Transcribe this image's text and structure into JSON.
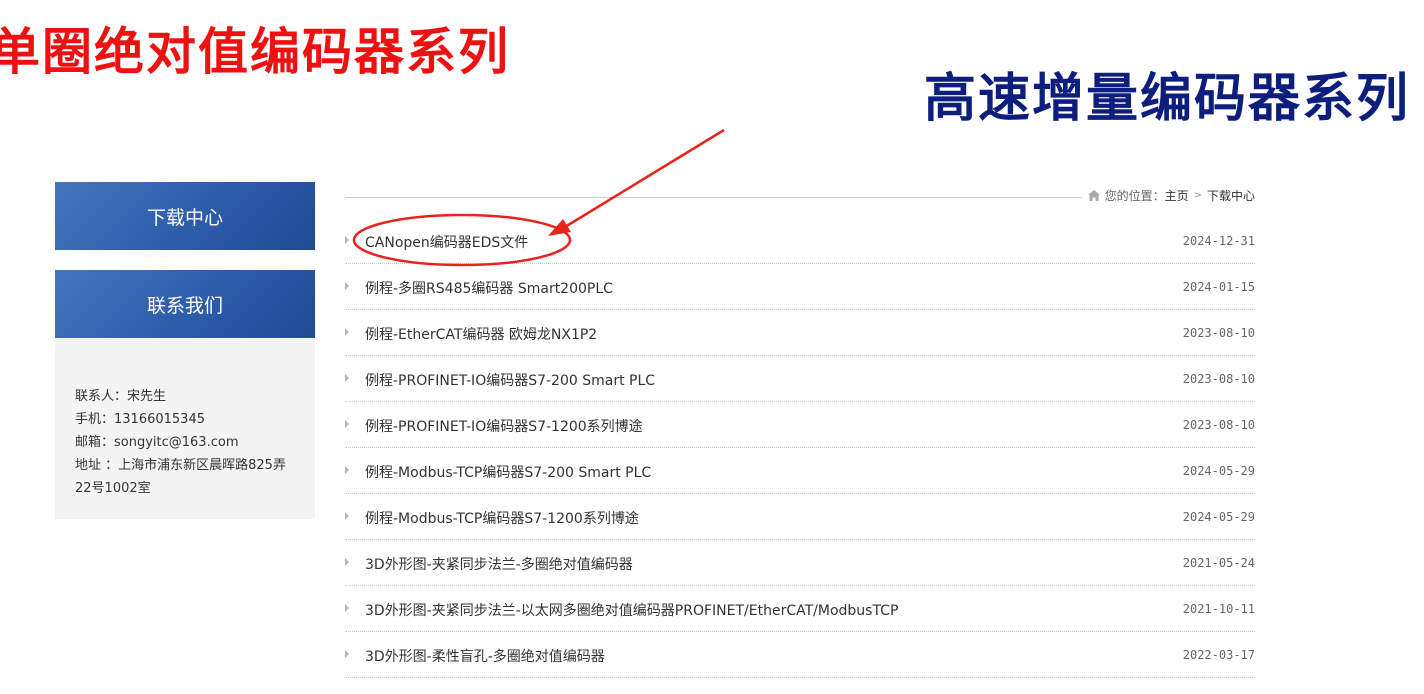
{
  "banners": {
    "left": "单圈绝对值编码器系列",
    "right": "高速增量编码器系列"
  },
  "sidebar": {
    "download_center": "下载中心",
    "contact_us": "联系我们",
    "contact": {
      "person": "联系人：宋先生",
      "phone": "手机：13166015345",
      "email": "邮箱：songyitc@163.com",
      "address": "地址 ：上海市浦东新区晨晖路825弄22号1002室"
    }
  },
  "breadcrumb": {
    "icon": "home-icon",
    "label": "您的位置：",
    "home": "主页",
    "separator": ">",
    "current": "下载中心"
  },
  "downloads": [
    {
      "title": "CANopen编码器EDS文件",
      "date": "2024-12-31"
    },
    {
      "title": "例程-多圈RS485编码器 Smart200PLC",
      "date": "2024-01-15"
    },
    {
      "title": "例程-EtherCAT编码器 欧姆龙NX1P2",
      "date": "2023-08-10"
    },
    {
      "title": "例程-PROFINET-IO编码器S7-200 Smart PLC",
      "date": "2023-08-10"
    },
    {
      "title": "例程-PROFINET-IO编码器S7-1200系列博途",
      "date": "2023-08-10"
    },
    {
      "title": "例程-Modbus-TCP编码器S7-200 Smart PLC",
      "date": "2024-05-29"
    },
    {
      "title": "例程-Modbus-TCP编码器S7-1200系列博途",
      "date": "2024-05-29"
    },
    {
      "title": "3D外形图-夹紧同步法兰-多圈绝对值编码器",
      "date": "2021-05-24"
    },
    {
      "title": "3D外形图-夹紧同步法兰-以太网多圈绝对值编码器PROFINET/EtherCAT/ModbusTCP",
      "date": "2021-10-11"
    },
    {
      "title": "3D外形图-柔性盲孔-多圈绝对值编码器",
      "date": "2022-03-17"
    }
  ],
  "colors": {
    "banner_red": "#ee1111",
    "banner_blue": "#0e1e7c",
    "sidebar_blue": "#2d5ca9",
    "annotation_red": "#e8231c"
  }
}
